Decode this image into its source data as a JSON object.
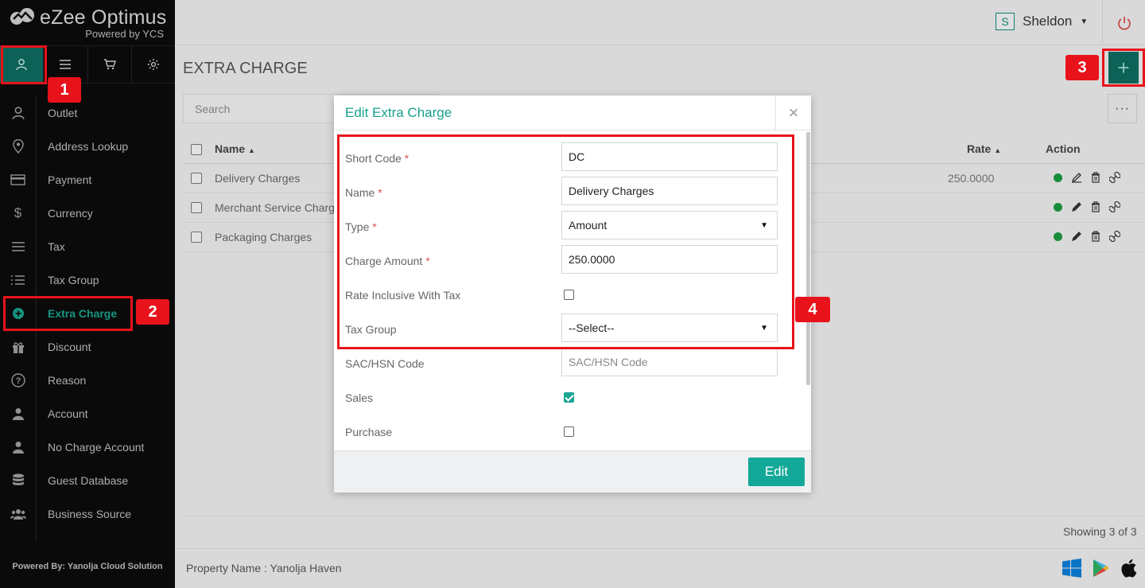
{
  "app": {
    "logo_title": "eZee Optimus",
    "logo_subtitle": "Powered by YCS",
    "footer_powered": "Powered By: Yanolja Cloud Solution"
  },
  "side_tabs": [
    {
      "icon": "user-icon",
      "active": true
    },
    {
      "icon": "menu-icon",
      "active": false
    },
    {
      "icon": "cart-icon",
      "active": false
    },
    {
      "icon": "gear-icon",
      "active": false
    }
  ],
  "menu": [
    {
      "icon": "user-icon",
      "label": "Outlet"
    },
    {
      "icon": "map-pin-icon",
      "label": "Address Lookup"
    },
    {
      "icon": "credit-card-icon",
      "label": "Payment"
    },
    {
      "icon": "dollar-icon",
      "label": "Currency"
    },
    {
      "icon": "lines-icon",
      "label": "Tax"
    },
    {
      "icon": "list-icon",
      "label": "Tax Group"
    },
    {
      "icon": "plus-circle-icon",
      "label": "Extra Charge",
      "active": true
    },
    {
      "icon": "gift-icon",
      "label": "Discount"
    },
    {
      "icon": "question-icon",
      "label": "Reason"
    },
    {
      "icon": "person-icon",
      "label": "Account"
    },
    {
      "icon": "person-icon",
      "label": "No Charge Account"
    },
    {
      "icon": "database-icon",
      "label": "Guest Database"
    },
    {
      "icon": "users-icon",
      "label": "Business Source"
    }
  ],
  "topbar": {
    "avatar_letter": "S",
    "user_name": "Sheldon"
  },
  "page": {
    "title": "EXTRA CHARGE",
    "search_placeholder": "Search",
    "add_label": "+",
    "more_label": "···"
  },
  "table": {
    "columns": {
      "name": "Name",
      "rate": "Rate",
      "action": "Action"
    },
    "rows": [
      {
        "name": "Delivery Charges",
        "rate": "250.0000"
      },
      {
        "name": "Merchant Service Charg",
        "rate": ""
      },
      {
        "name": "Packaging Charges",
        "rate": ""
      }
    ],
    "showing": "Showing 3 of 3"
  },
  "footer": {
    "property": "Property Name : Yanolja Haven"
  },
  "modal": {
    "title": "Edit Extra Charge",
    "close": "×",
    "fields": {
      "short_code": {
        "label": "Short Code",
        "required": "*",
        "value": "DC"
      },
      "name": {
        "label": "Name",
        "required": "*",
        "value": "Delivery Charges"
      },
      "type": {
        "label": "Type",
        "required": "*",
        "value": "Amount"
      },
      "charge_amount": {
        "label": "Charge Amount",
        "required": "*",
        "value": "250.0000"
      },
      "rate_inclusive": {
        "label": "Rate Inclusive With Tax",
        "checked": false
      },
      "tax_group": {
        "label": "Tax Group",
        "value": "--Select--"
      },
      "sac_hsn": {
        "label": "SAC/HSN Code",
        "placeholder": "SAC/HSN Code"
      },
      "sales": {
        "label": "Sales",
        "checked": true
      },
      "purchase": {
        "label": "Purchase",
        "checked": false
      }
    },
    "edit_label": "Edit"
  },
  "callouts": [
    "1",
    "2",
    "3",
    "4"
  ],
  "colors": {
    "accent": "#17a18d",
    "sidebar_bg": "#0b0b0b",
    "callout": "#e8121b",
    "active_tab": "#0f6b5f"
  }
}
